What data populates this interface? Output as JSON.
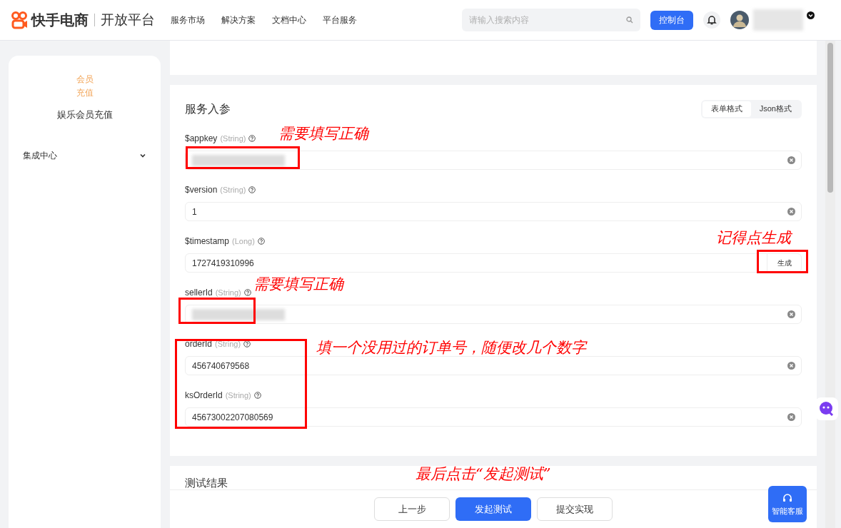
{
  "header": {
    "brand": "快手电商",
    "product": "开放平台",
    "nav": [
      "服务市场",
      "解决方案",
      "文档中心",
      "平台服务"
    ],
    "search": {
      "placeholder": "请输入搜索内容"
    },
    "console_button": "控制台",
    "user": {
      "redacted": true
    }
  },
  "sidebar": {
    "category": [
      "会员",
      "充值"
    ],
    "title": "娱乐会员充值",
    "items": [
      {
        "label": "集成中心",
        "expanded": false
      }
    ]
  },
  "params": {
    "title": "服务入参",
    "modes": [
      {
        "label": "表单格式",
        "selected": true
      },
      {
        "label": "Json格式",
        "selected": false
      }
    ],
    "fields": [
      {
        "kind": "redacted",
        "name": "$appkey",
        "type": "(String)"
      },
      {
        "kind": "text",
        "name": "$version",
        "type": "(String)",
        "value": "1"
      },
      {
        "kind": "generate",
        "name": "$timestamp",
        "type": "(Long)",
        "value": "1727419310996",
        "action": "生成"
      },
      {
        "kind": "redacted",
        "name": "sellerId",
        "type": "(String)"
      },
      {
        "kind": "text",
        "name": "orderId",
        "type": "(String)",
        "value": "456740679568"
      },
      {
        "kind": "text",
        "name": "ksOrderId",
        "type": "(String)",
        "value": "45673002207080569"
      }
    ]
  },
  "result": {
    "title": "测试结果"
  },
  "footer": {
    "buttons": [
      {
        "label": "上一步",
        "primary": false
      },
      {
        "label": "发起测试",
        "primary": true
      },
      {
        "label": "提交实现",
        "primary": false
      }
    ]
  },
  "support_button": "智能客服",
  "annotations": [
    "需要填写正确",
    "记得点生成",
    "需要填写正确",
    "填一个没用过的订单号，随便改几个数字",
    "最后点击“发起测试”"
  ]
}
